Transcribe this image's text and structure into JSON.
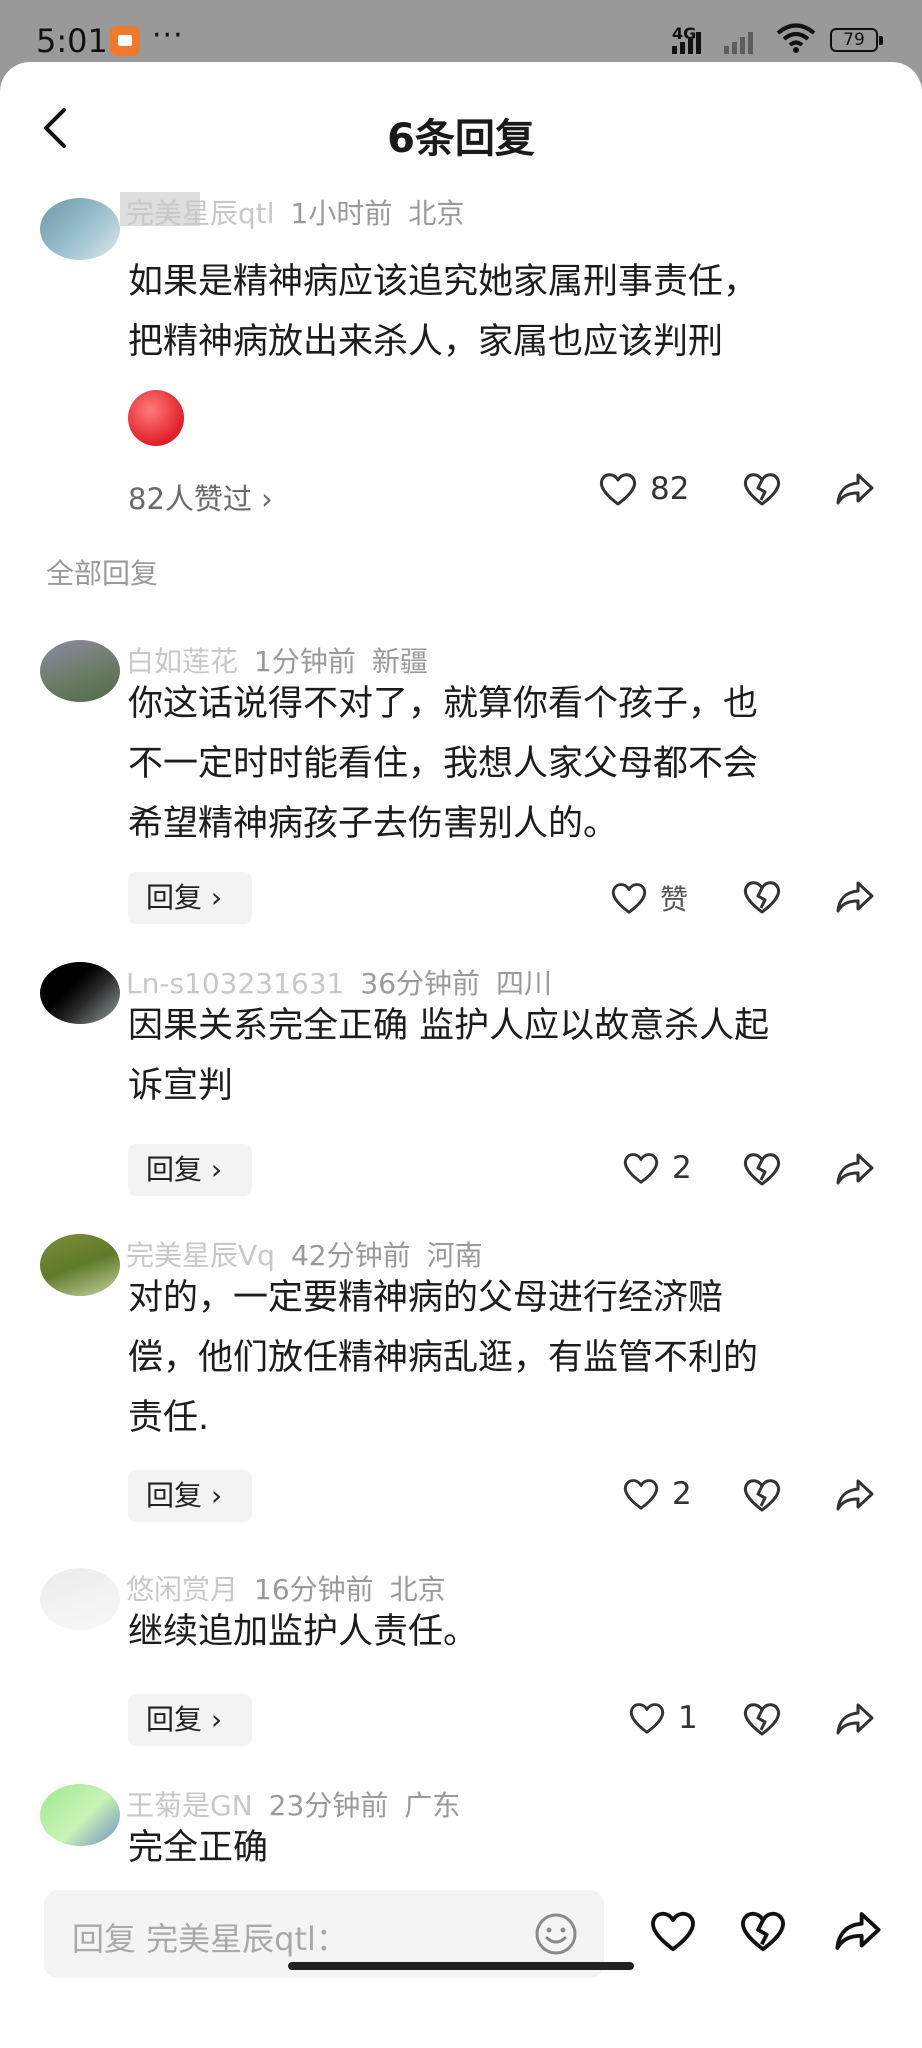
{
  "status_bar": {
    "time": "5:01",
    "dots": "···",
    "network": "4G",
    "battery": "79"
  },
  "header": {
    "title": "6条回复"
  },
  "main_comment": {
    "username": "完美星辰qtl",
    "time": "1小时前",
    "location": "北京",
    "text_lines": [
      "如果是精神病应该追究她家属刑事责任，",
      "把精神病放出来杀人，家属也应该判刑"
    ],
    "emoji": "angry-face",
    "likes_summary": "82人赞过 ›",
    "like_count": "82"
  },
  "section_label": "全部回复",
  "replies": [
    {
      "username": "白如莲花",
      "time": "1分钟前",
      "location": "新疆",
      "text_lines": [
        "你这话说得不对了，就算你看个孩子，也",
        "不一定时时能看住，我想人家父母都不会",
        "希望精神病孩子去伤害别人的。"
      ],
      "reply_label": "回复 ›",
      "like_label": "赞"
    },
    {
      "username": "Ln-s103231631",
      "time": "36分钟前",
      "location": "四川",
      "text_lines": [
        "因果关系完全正确 监护人应以故意杀人起",
        "诉宣判"
      ],
      "reply_label": "回复 ›",
      "like_count": "2"
    },
    {
      "username": "完美星辰Vq",
      "time": "42分钟前",
      "location": "河南",
      "text_lines": [
        "对的，一定要精神病的父母进行经济赔",
        "偿，他们放任精神病乱逛，有监管不利的",
        "责任."
      ],
      "reply_label": "回复 ›",
      "like_count": "2"
    },
    {
      "username": "悠闲赏月",
      "time": "16分钟前",
      "location": "北京",
      "text_lines": [
        "继续追加监护人责任。"
      ],
      "reply_label": "回复 ›",
      "like_count": "1"
    },
    {
      "username": "王菊是GN",
      "time": "23分钟前",
      "location": "广东",
      "text_lines": [
        "完全正确"
      ]
    }
  ],
  "bottom_bar": {
    "input_placeholder": "回复 完美星辰qtl："
  },
  "colors": {
    "background": "#ffffff",
    "meta_text": "#9a9a9a",
    "chip_bg": "#f3f3f3",
    "status_bg": "#9a9a9a"
  },
  "icons": {
    "back": "chevron-left-icon",
    "like": "heart-icon",
    "dislike": "broken-heart-icon",
    "share": "share-arrow-icon",
    "emoji": "smiley-icon"
  }
}
